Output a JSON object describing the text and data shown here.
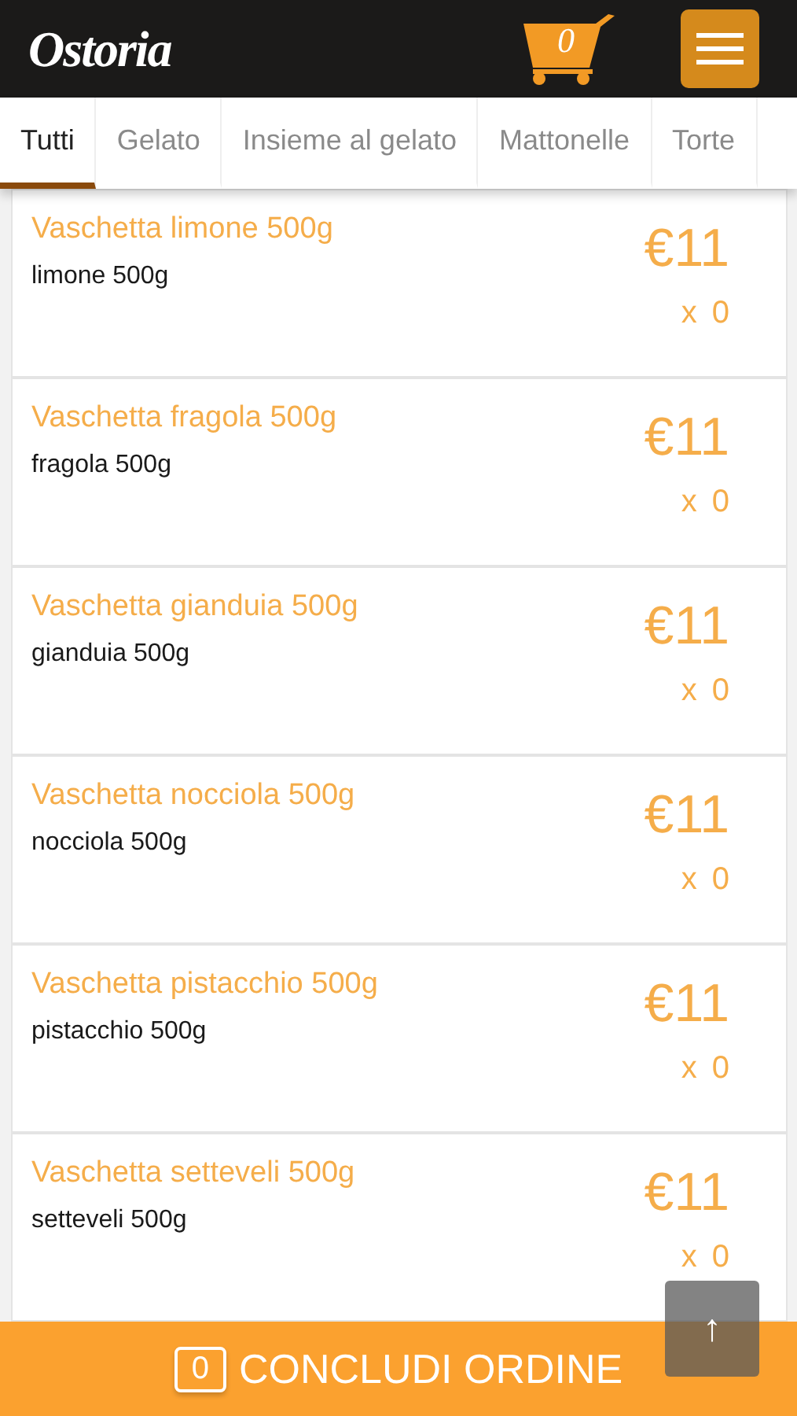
{
  "header": {
    "logo": "Ostoria",
    "cart_count": "0"
  },
  "tabs": [
    {
      "label": "Tutti",
      "selected": true
    },
    {
      "label": "Gelato",
      "selected": false
    },
    {
      "label": "Insieme al gelato",
      "selected": false
    },
    {
      "label": "Mattonelle",
      "selected": false
    },
    {
      "label": "Torte",
      "selected": false
    }
  ],
  "products": [
    {
      "title": "Vaschetta limone 500g",
      "description": "limone 500g",
      "price": "€11",
      "quantity": "x 0"
    },
    {
      "title": "Vaschetta fragola 500g",
      "description": "fragola 500g",
      "price": "€11",
      "quantity": "x 0"
    },
    {
      "title": "Vaschetta gianduia 500g",
      "description": "gianduia 500g",
      "price": "€11",
      "quantity": "x 0"
    },
    {
      "title": "Vaschetta nocciola 500g",
      "description": "nocciola 500g",
      "price": "€11",
      "quantity": "x 0"
    },
    {
      "title": "Vaschetta pistacchio 500g",
      "description": "pistacchio 500g",
      "price": "€11",
      "quantity": "x 0"
    },
    {
      "title": "Vaschetta setteveli 500g",
      "description": "setteveli 500g",
      "price": "€11",
      "quantity": "x 0"
    }
  ],
  "order_bar": {
    "count": "0",
    "label": "CONCLUDI ORDINE"
  },
  "scroll_top": {
    "label": "↑"
  }
}
